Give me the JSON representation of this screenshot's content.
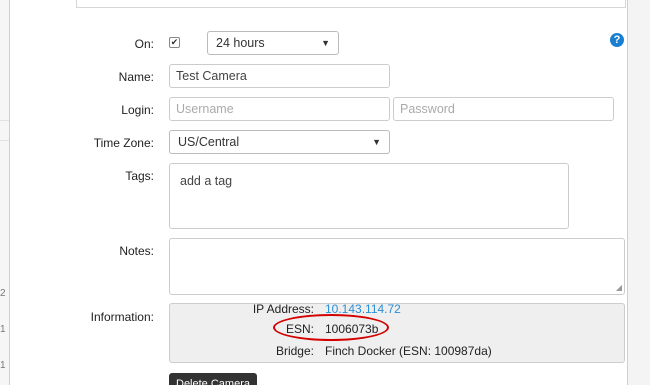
{
  "background": {
    "row_numbers": [
      "2",
      "1",
      "1"
    ]
  },
  "form": {
    "on": {
      "label": "On:",
      "checked": true,
      "duration_value": "24 hours"
    },
    "help_icon": "question-circle-icon",
    "name": {
      "label": "Name:",
      "value": "Test Camera"
    },
    "login": {
      "label": "Login:",
      "username_placeholder": "Username",
      "password_placeholder": "Password"
    },
    "timezone": {
      "label": "Time Zone:",
      "value": "US/Central"
    },
    "tags": {
      "label": "Tags:",
      "placeholder": "add a tag"
    },
    "notes": {
      "label": "Notes:"
    },
    "information": {
      "label": "Information:",
      "rows": [
        {
          "key": "IP Address:",
          "value": "10.143.114.72"
        },
        {
          "key": "ESN:",
          "value": "1006073b"
        },
        {
          "key": "Bridge:",
          "value": "Finch Docker (ESN: 100987da)"
        }
      ]
    },
    "delete_label": "Delete Camera"
  },
  "colors": {
    "accent": "#1a7fd1",
    "highlight": "#d40000",
    "button": "#333333"
  }
}
